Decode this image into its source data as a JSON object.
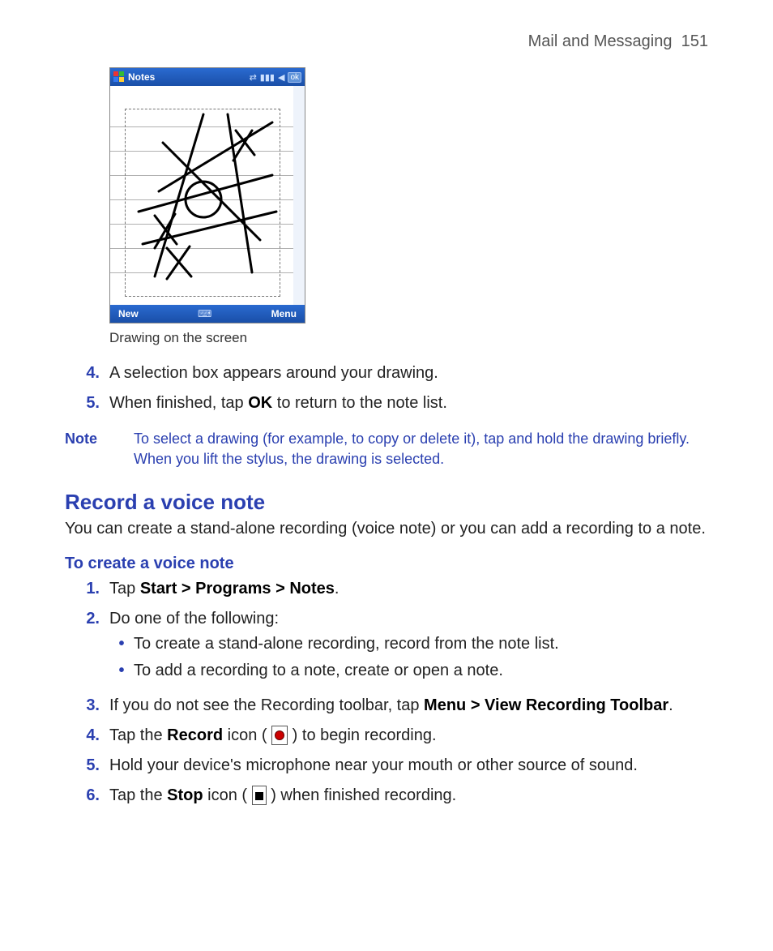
{
  "header": {
    "chapter": "Mail and Messaging",
    "page": "151"
  },
  "device": {
    "title": "Notes",
    "ok": "ok",
    "new_label": "New",
    "menu_label": "Menu"
  },
  "caption": "Drawing on the screen",
  "steps_a": [
    {
      "num": "4.",
      "text": "A selection box appears around your drawing."
    },
    {
      "num": "5.",
      "pre": "When finished, tap ",
      "bold": "OK",
      "post": " to return to the note list."
    }
  ],
  "note": {
    "label": "Note",
    "text": "To select a drawing (for example, to copy or delete it), tap and hold the drawing briefly. When you lift the stylus, the drawing is selected."
  },
  "section_title": "Record a voice note",
  "section_intro": "You can create a stand-alone recording (voice note) or you can add a recording to a note.",
  "subhead": "To create a voice note",
  "steps_b": {
    "s1": {
      "num": "1.",
      "pre": "Tap ",
      "bold": "Start > Programs > Notes",
      "post": "."
    },
    "s2": {
      "num": "2.",
      "text": "Do one of the following:"
    },
    "s2_bullets": [
      "To create a stand-alone recording, record from the note list.",
      "To add a recording to a note, create or open a note."
    ],
    "s3": {
      "num": "3.",
      "pre": "If you do not see the Recording toolbar, tap ",
      "bold": "Menu > View Recording Toolbar",
      "post": "."
    },
    "s4": {
      "num": "4.",
      "pre": "Tap the ",
      "bold": "Record",
      "mid": " icon ( ",
      "post": " ) to begin recording."
    },
    "s5": {
      "num": "5.",
      "text": "Hold your device's microphone near your mouth or other source of sound."
    },
    "s6": {
      "num": "6.",
      "pre": "Tap the ",
      "bold": "Stop",
      "mid": " icon ( ",
      "post": " ) when finished recording."
    }
  }
}
